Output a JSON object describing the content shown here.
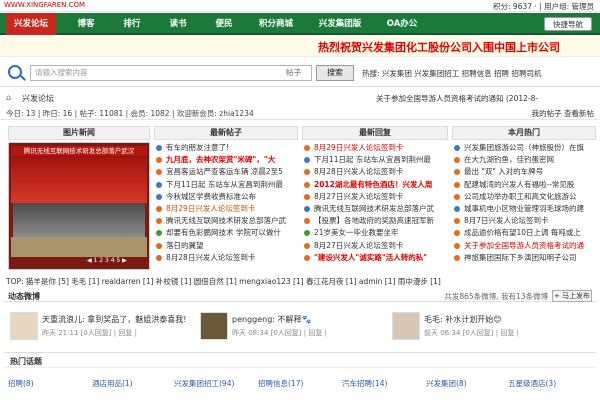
{
  "topbar": {
    "site": "WWW.XINGFAREN.COM",
    "right": "积分: 9637 · | 用户组: 管理员"
  },
  "nav": {
    "items": [
      "兴发论坛",
      "博客",
      "排行",
      "读书",
      "便民",
      "积分商城",
      "兴发集团版",
      "OA办公"
    ],
    "download": "快捷导航"
  },
  "banner": {
    "text": "热烈祝贺兴发集团化工股份公司入围中国上市公司"
  },
  "search": {
    "placeholder": "请输入搜索内容",
    "select": "帖子",
    "button": "搜索",
    "hot": "热搜: 兴发集团 兴发集团招工 招聘信息 招聘 招聘司机"
  },
  "crumb": {
    "home": "⌂",
    "name": "兴发论坛",
    "notice": "关于参加全国导游人员资格考试的通知   (2012-8-"
  },
  "stats": {
    "text": "今日: 13 | 昨日: 16 | 帖子: 11081 | 会员: 1082 | 欢迎新会员: zhia1234",
    "right": "我的帖子   查看新帖"
  },
  "columns": [
    "图片新闻",
    "最新帖子",
    "最新回复",
    "本月热门"
  ],
  "photo": {
    "caption": "腾讯无线互联网技术研发总部落户武汉",
    "controls": "◀ 1 2 3 4 5 ▶"
  },
  "latest_posts": [
    {
      "t": "有车的朋友注意了!",
      "c": "blue"
    },
    {
      "t": "九月底，去神农架赏\"米碑\"，\"大",
      "c": "redb"
    },
    {
      "t": "宜昌客运站严查客运车辆 凉晨2至5",
      "c": ""
    },
    {
      "t": "下月11日起 东站车从宜昌到荆州最",
      "c": "blue"
    },
    {
      "t": "今秋城区学费收费标准公布",
      "c": "blue"
    },
    {
      "t": "8月29日兴发人论坛签到卡",
      "c": "ora"
    },
    {
      "t": "腾讯无线互联网技术研发总部落户武",
      "c": ""
    },
    {
      "t": "却要有色彩鹏网技术 学院可以做什",
      "c": "green"
    },
    {
      "t": "落日的翼望",
      "c": ""
    },
    {
      "t": "8月28日兴发人论坛签到卡",
      "c": ""
    }
  ],
  "latest_replies": [
    {
      "t": "8月29日兴发人论坛签到卡",
      "c": "red"
    },
    {
      "t": "下月11日起 东站车从宜昌到荆州最",
      "c": "blue"
    },
    {
      "t": "8月28日兴发人论坛签到卡",
      "c": ""
    },
    {
      "t": "2012湖北最有特色酒店！兴发人周",
      "c": "redb"
    },
    {
      "t": "8月27日兴发人论坛签到卡",
      "c": ""
    },
    {
      "t": "腾讯无线互联网技术研发总部落户武",
      "c": "blue"
    },
    {
      "t": "【投票】各地政府的奖励高速冠军新",
      "c": ""
    },
    {
      "t": "21岁美女一毕业教要坐牢",
      "c": "green"
    },
    {
      "t": "8月27日兴发人论坛签到卡",
      "c": ""
    },
    {
      "t": "\"建设兴发人\"诚实路\"活人转的私\"",
      "c": "redb"
    }
  ],
  "hot_month": [
    {
      "t": "兴发集团旅游公司（神旅股份）在旗",
      "c": "blue"
    },
    {
      "t": "在大九湖钓鱼，佳钓蛋密网",
      "c": ""
    },
    {
      "t": "最出 \"双\" 入对的车牌号",
      "c": ""
    },
    {
      "t": "配建城湾的兴发人有福啦--常见股",
      "c": ""
    },
    {
      "t": "公司成功举办职工和高文化旅游公",
      "c": ""
    },
    {
      "t": "城事机电小区物业管理羽毛球场的建",
      "c": "blue"
    },
    {
      "t": "8月7日兴发人论坛签到卡",
      "c": ""
    },
    {
      "t": "成品逾价格有望10日上调 每吨或上",
      "c": ""
    },
    {
      "t": "关于参加全国导游人员资格考试的通",
      "c": "red"
    },
    {
      "t": "神旅集团国际下乡演团知明子公司",
      "c": ""
    }
  ],
  "top_users": "TOP: 猫羊是你 [5] 毛毛 [1] realdarren [1] 补校镜 [1] 圆佃自然 [1] mengxiao123 [1] 春江花月夜 [1] admin [1] 雨中漫步 [1]",
  "section": {
    "title": "动态微博",
    "count": "共发865条微博, 我有13条微博",
    "button": "+ 马上发布"
  },
  "weibo": [
    {
      "name": "天重流浪儿: 拿到奖品了，魅姐洪泰喜我!",
      "meta": "昨天 21:11 [0人回复] | 回复 |"
    },
    {
      "name": "penggeng: 不解释🐾",
      "meta": "昨天 08:34 [0人回复] | 回复 |"
    },
    {
      "name": "毛毛: 补水计划开始😊",
      "meta": "前天 06:34 [0人回复] | 回复 |"
    }
  ],
  "hot_tags_title": "热门话题",
  "hot_tags": [
    "招聘(8)",
    "酒店用品(1)",
    "兴发集团招工(94)",
    "招聘信息(17)",
    "汽车招聘(14)",
    "兴发集团(8)",
    "五星级酒店(3)"
  ]
}
